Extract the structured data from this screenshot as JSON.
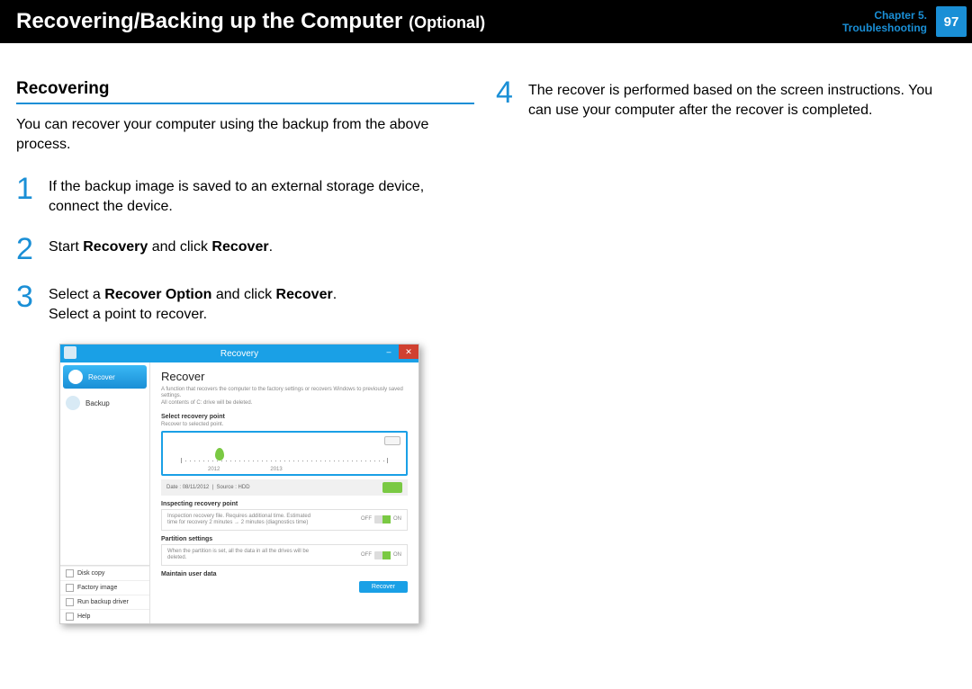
{
  "header": {
    "title_main": "Recovering/Backing up the Computer",
    "title_suffix": "(Optional)",
    "chapter_line1": "Chapter 5.",
    "chapter_line2": "Troubleshooting",
    "page_number": "97"
  },
  "left": {
    "section_title": "Recovering",
    "intro": "You can recover your computer using the backup from the above process.",
    "steps": {
      "s1_num": "1",
      "s1_text": "If the backup image is saved to an external storage device, connect the device.",
      "s2_num": "2",
      "s2_prefix": "Start ",
      "s2_b1": "Recovery",
      "s2_mid": " and click ",
      "s2_b2": "Recover",
      "s2_suffix": ".",
      "s3_num": "3",
      "s3_prefix": "Select a ",
      "s3_b1": "Recover Option",
      "s3_mid": " and click ",
      "s3_b2": "Recover",
      "s3_suffix": ".",
      "s3_line2": "Select a point to recover."
    }
  },
  "right": {
    "s4_num": "4",
    "s4_text": "The recover is performed based on the screen instructions. You can use your computer after the recover is completed."
  },
  "app": {
    "window_title": "Recovery",
    "sidebar": {
      "recover": "Recover",
      "backup": "Backup",
      "disk_copy": "Disk copy",
      "factory_image": "Factory image",
      "run_backup_driver": "Run backup driver",
      "help": "Help"
    },
    "main": {
      "heading": "Recover",
      "desc1": "A function that recovers the computer to the factory settings or recovers Windows to previously saved settings.",
      "desc2": "All contents of C: drive will be deleted.",
      "select_point_label": "Select recovery point",
      "select_point_sub": "Recover to selected point.",
      "year1": "2012",
      "year2": "2013",
      "info_date_label": "Date :",
      "info_date_value": "08/11/2012",
      "info_src_label": "Source :",
      "info_src_value": "HDD",
      "inspect_label": "Inspecting recovery point",
      "inspect_text": "Inspection recovery file. Requires additional time. Estimated time for recovery 2 minutes → 2 minutes (diagnostics time)",
      "partition_label": "Partition settings",
      "partition_text": "When the partition is set, all the data in all the drives will be deleted.",
      "maintain_label": "Maintain user data",
      "off": "OFF",
      "on": "ON",
      "recover_btn": "Recover"
    }
  }
}
